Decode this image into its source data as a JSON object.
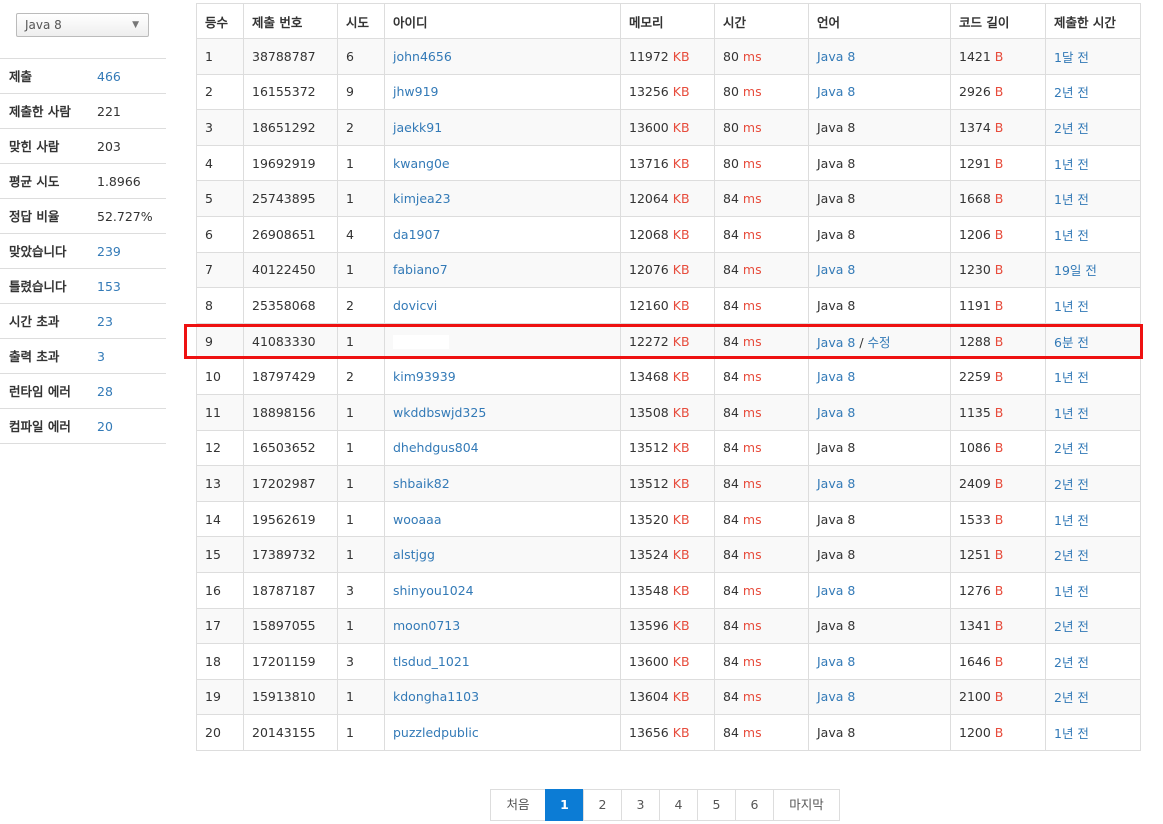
{
  "filter": {
    "language_selected": "Java 8"
  },
  "stats": [
    {
      "label": "제출",
      "value": "466",
      "link": true
    },
    {
      "label": "제출한 사람",
      "value": "221",
      "link": false
    },
    {
      "label": "맞힌 사람",
      "value": "203",
      "link": false
    },
    {
      "label": "평균 시도",
      "value": "1.8966",
      "link": false
    },
    {
      "label": "정답 비율",
      "value": "52.727%",
      "link": false
    },
    {
      "label": "맞았습니다",
      "value": "239",
      "link": true
    },
    {
      "label": "틀렸습니다",
      "value": "153",
      "link": true
    },
    {
      "label": "시간 초과",
      "value": "23",
      "link": true
    },
    {
      "label": "출력 초과",
      "value": "3",
      "link": true
    },
    {
      "label": "런타임 에러",
      "value": "28",
      "link": true
    },
    {
      "label": "컴파일 에러",
      "value": "20",
      "link": true
    }
  ],
  "table": {
    "headers": [
      "등수",
      "제출 번호",
      "시도",
      "아이디",
      "메모리",
      "시간",
      "언어",
      "코드 길이",
      "제출한 시간"
    ],
    "memory_unit": "KB",
    "time_unit": "ms",
    "length_unit": "B",
    "edit_label": "수정",
    "rows": [
      {
        "rank": "1",
        "id": "38788787",
        "tries": "6",
        "user": "john4656",
        "mem": "11972",
        "time": "80",
        "lang": "Java 8",
        "lang_link": true,
        "len": "1421",
        "when": "1달 전"
      },
      {
        "rank": "2",
        "id": "16155372",
        "tries": "9",
        "user": "jhw919",
        "mem": "13256",
        "time": "80",
        "lang": "Java 8",
        "lang_link": true,
        "len": "2926",
        "when": "2년 전"
      },
      {
        "rank": "3",
        "id": "18651292",
        "tries": "2",
        "user": "jaekk91",
        "mem": "13600",
        "time": "80",
        "lang": "Java 8",
        "lang_link": false,
        "len": "1374",
        "when": "2년 전"
      },
      {
        "rank": "4",
        "id": "19692919",
        "tries": "1",
        "user": "kwang0e",
        "mem": "13716",
        "time": "80",
        "lang": "Java 8",
        "lang_link": false,
        "len": "1291",
        "when": "1년 전"
      },
      {
        "rank": "5",
        "id": "25743895",
        "tries": "1",
        "user": "kimjea23",
        "mem": "12064",
        "time": "84",
        "lang": "Java 8",
        "lang_link": false,
        "len": "1668",
        "when": "1년 전"
      },
      {
        "rank": "6",
        "id": "26908651",
        "tries": "4",
        "user": "da1907",
        "mem": "12068",
        "time": "84",
        "lang": "Java 8",
        "lang_link": false,
        "len": "1206",
        "when": "1년 전"
      },
      {
        "rank": "7",
        "id": "40122450",
        "tries": "1",
        "user": "fabiano7",
        "mem": "12076",
        "time": "84",
        "lang": "Java 8",
        "lang_link": true,
        "len": "1230",
        "when": "19일 전"
      },
      {
        "rank": "8",
        "id": "25358068",
        "tries": "2",
        "user": "dovicvi",
        "mem": "12160",
        "time": "84",
        "lang": "Java 8",
        "lang_link": false,
        "len": "1191",
        "when": "1년 전"
      },
      {
        "rank": "9",
        "id": "41083330",
        "tries": "1",
        "user": "",
        "mem": "12272",
        "time": "84",
        "lang": "Java 8",
        "lang_link": true,
        "edit": true,
        "len": "1288",
        "when": "6분 전"
      },
      {
        "rank": "10",
        "id": "18797429",
        "tries": "2",
        "user": "kim93939",
        "mem": "13468",
        "time": "84",
        "lang": "Java 8",
        "lang_link": true,
        "len": "2259",
        "when": "1년 전"
      },
      {
        "rank": "11",
        "id": "18898156",
        "tries": "1",
        "user": "wkddbswjd325",
        "mem": "13508",
        "time": "84",
        "lang": "Java 8",
        "lang_link": true,
        "len": "1135",
        "when": "1년 전"
      },
      {
        "rank": "12",
        "id": "16503652",
        "tries": "1",
        "user": "dhehdgus804",
        "mem": "13512",
        "time": "84",
        "lang": "Java 8",
        "lang_link": false,
        "len": "1086",
        "when": "2년 전"
      },
      {
        "rank": "13",
        "id": "17202987",
        "tries": "1",
        "user": "shbaik82",
        "mem": "13512",
        "time": "84",
        "lang": "Java 8",
        "lang_link": true,
        "len": "2409",
        "when": "2년 전"
      },
      {
        "rank": "14",
        "id": "19562619",
        "tries": "1",
        "user": "wooaaa",
        "mem": "13520",
        "time": "84",
        "lang": "Java 8",
        "lang_link": false,
        "len": "1533",
        "when": "1년 전"
      },
      {
        "rank": "15",
        "id": "17389732",
        "tries": "1",
        "user": "alstjgg",
        "mem": "13524",
        "time": "84",
        "lang": "Java 8",
        "lang_link": false,
        "len": "1251",
        "when": "2년 전"
      },
      {
        "rank": "16",
        "id": "18787187",
        "tries": "3",
        "user": "shinyou1024",
        "mem": "13548",
        "time": "84",
        "lang": "Java 8",
        "lang_link": true,
        "len": "1276",
        "when": "1년 전"
      },
      {
        "rank": "17",
        "id": "15897055",
        "tries": "1",
        "user": "moon0713",
        "mem": "13596",
        "time": "84",
        "lang": "Java 8",
        "lang_link": false,
        "len": "1341",
        "when": "2년 전"
      },
      {
        "rank": "18",
        "id": "17201159",
        "tries": "3",
        "user": "tlsdud_1021",
        "mem": "13600",
        "time": "84",
        "lang": "Java 8",
        "lang_link": true,
        "len": "1646",
        "when": "2년 전"
      },
      {
        "rank": "19",
        "id": "15913810",
        "tries": "1",
        "user": "kdongha1103",
        "mem": "13604",
        "time": "84",
        "lang": "Java 8",
        "lang_link": true,
        "len": "2100",
        "when": "2년 전"
      },
      {
        "rank": "20",
        "id": "20143155",
        "tries": "1",
        "user": "puzzledpublic",
        "mem": "13656",
        "time": "84",
        "lang": "Java 8",
        "lang_link": false,
        "len": "1200",
        "when": "1년 전"
      }
    ]
  },
  "pagination": {
    "first": "처음",
    "pages": [
      "1",
      "2",
      "3",
      "4",
      "5",
      "6"
    ],
    "active": "1",
    "last": "마지막"
  },
  "colors": {
    "link": "#337ab7",
    "unit": "#e74c3c",
    "active_page": "#0c7cd5",
    "highlight_border": "#e11111"
  }
}
